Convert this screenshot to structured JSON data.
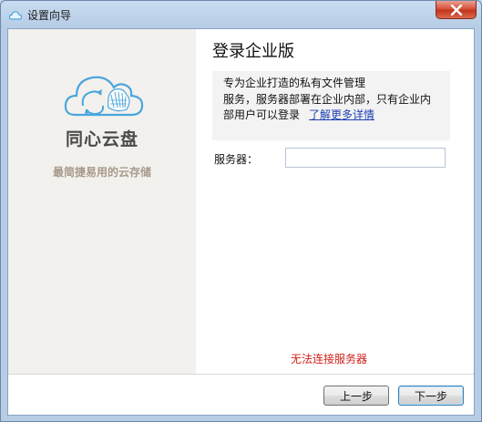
{
  "window": {
    "title": "设置向导",
    "icon": "cloud-icon",
    "close": "close-icon"
  },
  "sidebar": {
    "app_name": "同心云盘",
    "slogan": "最简捷易用的云存储",
    "logo": "cloud-sync-logo-icon"
  },
  "main": {
    "title": "登录企业版",
    "info_line1": "专为企业打造的私有文件管理",
    "info_line2": "服务，服务器部署在企业内部，只有企业内",
    "info_line3": "部用户可以登录",
    "more_link": "了解更多详情",
    "server_label": "服务器：",
    "server_value": "",
    "error": "无法连接服务器"
  },
  "footer": {
    "prev_label": "上一步",
    "next_label": "下一步"
  },
  "colors": {
    "accent_link": "#1d3fb3",
    "error": "#d0201a",
    "sidebar_bg": "#f3f1ee",
    "logo_blue": "#4aa6dd"
  }
}
